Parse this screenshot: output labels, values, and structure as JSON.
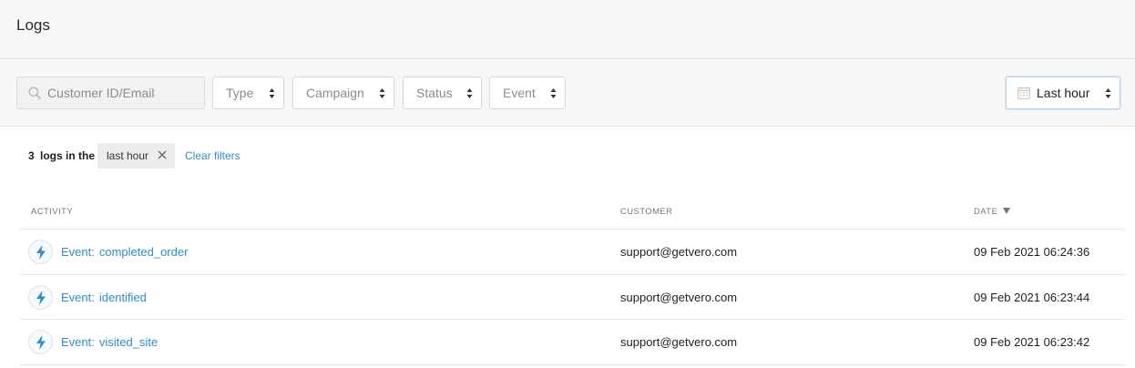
{
  "header": {
    "title": "Logs"
  },
  "filters": {
    "search_placeholder": "Customer ID/Email",
    "type": "Type",
    "campaign": "Campaign",
    "status": "Status",
    "event": "Event",
    "date_range": "Last hour"
  },
  "summary": {
    "count": "3",
    "text": "logs in the",
    "chip_label": "last hour",
    "clear_label": "Clear filters"
  },
  "table": {
    "columns": {
      "activity": "ACTIVITY",
      "customer": "CUSTOMER",
      "date": "DATE"
    },
    "sort_indicator": "descending",
    "rows": [
      {
        "prefix": "Event:",
        "name": "completed_order",
        "customer": "support@getvero.com",
        "date": "09 Feb 2021 06:24:36"
      },
      {
        "prefix": "Event:",
        "name": "identified",
        "customer": "support@getvero.com",
        "date": "09 Feb 2021 06:23:44"
      },
      {
        "prefix": "Event:",
        "name": "visited_site",
        "customer": "support@getvero.com",
        "date": "09 Feb 2021 06:23:42"
      }
    ]
  },
  "colors": {
    "link": "#2f8fc6",
    "header_bg": "#f7f7f7",
    "chip_bg": "#ededed"
  },
  "icons": {
    "search": "search-icon",
    "caret": "sort-caret-icon",
    "calendar": "calendar-icon",
    "remove": "close-icon",
    "event": "lightning-icon",
    "sort": "sort-down-icon"
  }
}
